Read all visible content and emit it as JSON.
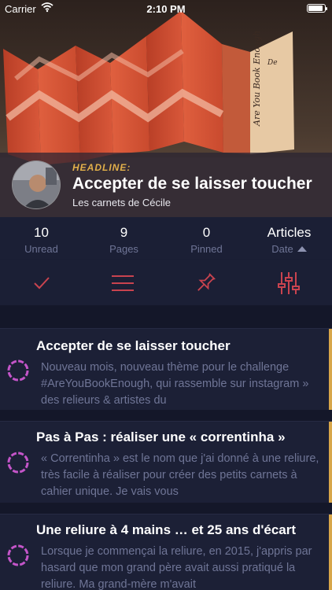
{
  "status_bar": {
    "carrier": "Carrier",
    "time": "2:10 PM",
    "battery_level": 0.9
  },
  "headline": {
    "label": "HEADLINE:",
    "title": "Accepter de se laisser toucher",
    "source": "Les carnets de Cécile"
  },
  "stats": [
    {
      "value": "10",
      "label": "Unread"
    },
    {
      "value": "9",
      "label": "Pages"
    },
    {
      "value": "0",
      "label": "Pinned"
    },
    {
      "value": "Articles",
      "label": "Date"
    }
  ],
  "toolbar": {
    "icons": [
      "checkmark-icon",
      "menu-icon",
      "pin-icon",
      "sliders-icon"
    ],
    "icon_color": "#c9434f"
  },
  "articles": [
    {
      "title": "Accepter de se laisser toucher",
      "excerpt": "Nouveau mois, nouveau thème pour le challenge #AreYouBookEnough, qui rassemble sur instagram » des relieurs & artistes du"
    },
    {
      "title": "Pas à Pas : réaliser une « correntinha »",
      "excerpt": "« Correntinha » est le nom que j'ai donné à une reliure, très facile à réaliser pour créer des petits carnets à cahier unique. Je vais vous"
    },
    {
      "title": "Une reliure à 4 mains … et 25 ans d'écart",
      "excerpt": "Lorsque je commençai la reliure, en 2015, j'appris par hasard que mon grand père avait aussi pratiqué la reliure. Ma grand-mère m'avait"
    }
  ],
  "colors": {
    "accent_gold": "#d7a64a",
    "unread_ring": "#c455c9",
    "icon_red": "#c9434f",
    "background": "#1b1f35"
  }
}
